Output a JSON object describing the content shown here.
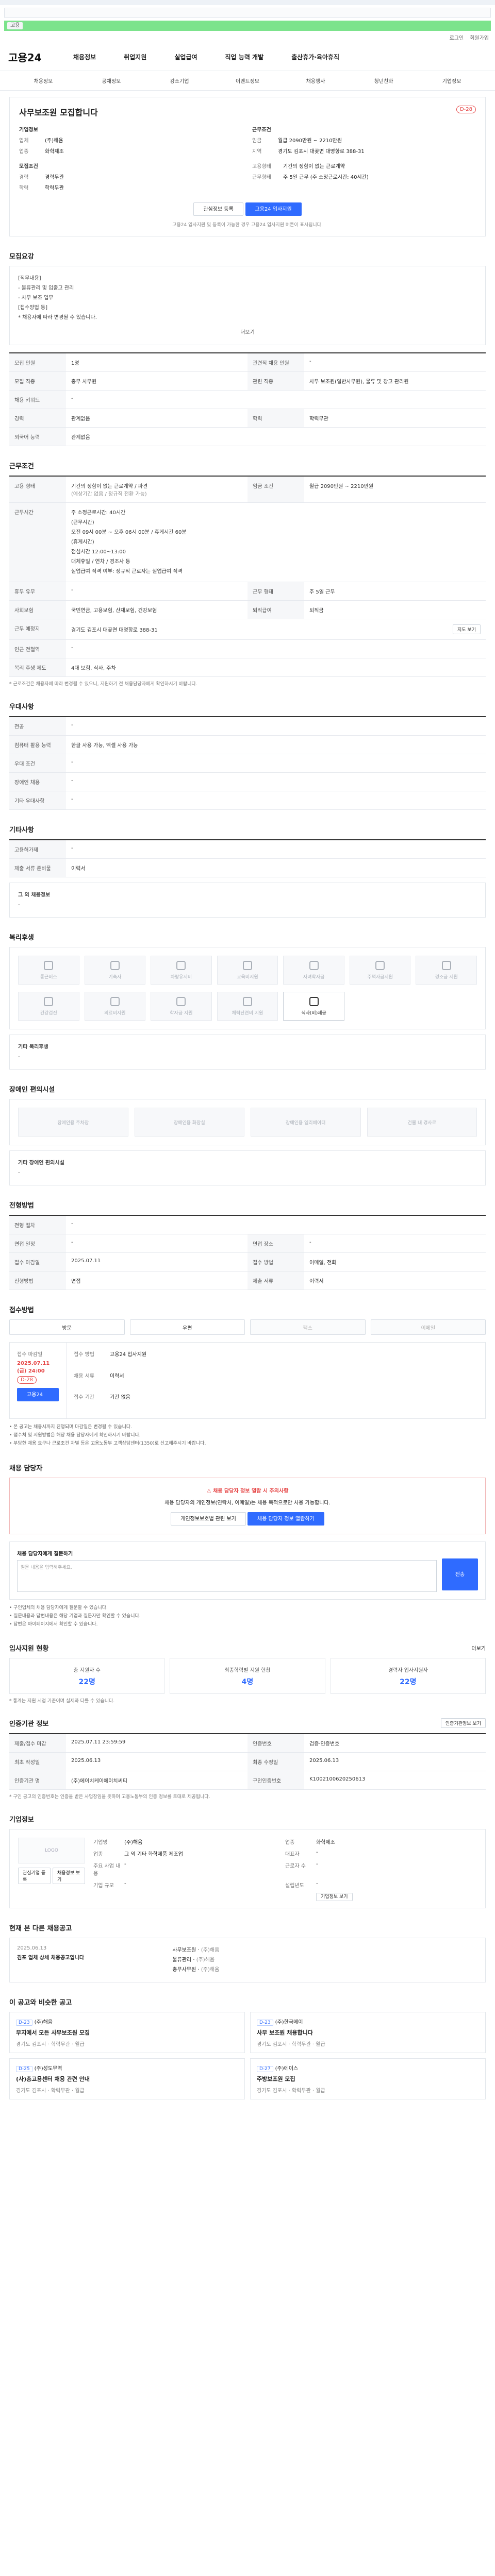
{
  "top": {
    "login": "로그인",
    "join": "회원가입"
  },
  "gnb": {
    "logo": "고용24",
    "menu": [
      "채용정보",
      "취업지원",
      "실업급여",
      "직업 능력 개발",
      "출산휴가·육아휴직"
    ]
  },
  "subnav": [
    "채용정보",
    "공채정보",
    "강소기업",
    "이벤트정보",
    "채용행사",
    "청년친화",
    "기업정보"
  ],
  "job": {
    "title": "사무보조원 모집합니다",
    "dday": "D-28",
    "company_title": "기업정보",
    "company_kv": [
      [
        "업체",
        "(주)해윰"
      ],
      [
        "업종",
        "화학제조"
      ]
    ],
    "cond_title": "모집조건",
    "cond_kv": [
      [
        "경력",
        "경력무관"
      ],
      [
        "학력",
        "학력무관"
      ]
    ],
    "work_title": "근무조건",
    "work_kv": [
      [
        "임금",
        "월급 2090만원 ~ 2210만원"
      ],
      [
        "지역",
        "경기도 김포시 대곶면 대명항로 388-31"
      ]
    ],
    "work_kv2": [
      [
        "고용형태",
        "기간의 정함이 없는 근로계약"
      ],
      [
        "근무형태",
        "주 5일 근무 (주 소정근로시간: 40시간)"
      ]
    ],
    "btn_apply": "고용24 입사지원",
    "btn_interest": "관심정보 등록",
    "note": "고용24 입사지원 및 등록이 가능한 경우 고용24 입사지원 버튼이 표시됩니다."
  },
  "recruit": {
    "section": "모집요강",
    "text": [
      "[직무내용]",
      "- 물류관리 및 입출고 관리",
      "- 사무 보조 업무",
      "[접수방법 등]",
      "* 채용자에 따라 변경될 수 있습니다."
    ],
    "more": "더보기",
    "rows": [
      [
        "모집 인원",
        "1명",
        "관련직 채용 인원",
        "-"
      ],
      [
        "모집 직종",
        "총무 사무원",
        "관련 직종",
        "사무 보조원(일반사무원), 물류 및 창고 관리원"
      ],
      [
        "채용 키워드",
        "-",
        "",
        ""
      ],
      [
        "경력",
        "관계없음",
        "학력",
        "학력무관"
      ],
      [
        "외국어 능력",
        "관계없음",
        "",
        ""
      ]
    ]
  },
  "work": {
    "section": "근무조건",
    "employ_type": "기간의 정함이 없는 근로계약 / 파견",
    "employ_type_sub": "(예상기간 없음 / 정규직 전환 가능)",
    "wage": "월급 2090만원 ~ 2210만원",
    "hours_label": "근무시간",
    "hours": [
      "주 소정근로시간: 40시간",
      "(근무시간)",
      "오전 09시 00분 ~ 오후 06시 00분 / 휴게시간 60분",
      "(휴게시간)",
      "점심시간 12:00~13:00",
      "대체휴일 / 연차 / 경조사 등",
      "실업급여 적격 여부: 정규직 근로자는 실업급여 적격"
    ],
    "rows": [
      [
        "휴무 유무",
        "-",
        "근무 형태",
        "주 5일 근무"
      ],
      [
        "사회보험",
        "국민연금, 고용보험, 산재보험, 건강보험",
        "퇴직급여",
        "퇴직금"
      ],
      [
        "근무 예정지",
        "경기도 김포시 대곶면 대명항로 388-31",
        "",
        ""
      ],
      [
        "인근 전철역",
        "-",
        "",
        ""
      ],
      [
        "복리 후생 제도",
        "4대 보험, 식사, 주차",
        "",
        ""
      ]
    ],
    "map_btn": "지도 보기",
    "tip": "* 근로조건은 채용자에 따라 변경될 수 있으니, 지원하기 전 채용담당자에게 확인하시기 바랍니다."
  },
  "apply_info": {
    "section": "우대사항",
    "rows": [
      [
        "전공",
        "-"
      ],
      [
        "컴퓨터 활용 능력",
        "한글 사용 가능, 엑셀 사용 가능"
      ],
      [
        "우대 조건",
        "-"
      ],
      [
        "장애인 채용",
        "-"
      ],
      [
        "기타 우대사항",
        "-"
      ]
    ]
  },
  "etc": {
    "section": "기타사항",
    "rows": [
      [
        "고용허가제",
        "-"
      ],
      [
        "제출 서류 준비물",
        "이력서"
      ]
    ],
    "sub": "그 외 채용정보",
    "sub_value": "-"
  },
  "welfare": {
    "section": "복리후생",
    "items": [
      "통근버스",
      "기숙사",
      "차량유지비",
      "교육비지원",
      "자녀학자금",
      "주택자금지원",
      "경조금 지원",
      "건강검진",
      "의료비지원",
      "학자금 지원",
      "체력단련비 지원",
      "식사(비)제공"
    ],
    "on_index": 11,
    "sub": "기타 복리후생",
    "sub_value": "-"
  },
  "disability": {
    "section": "장애인 편의시설",
    "items": [
      "장애인용 주차장",
      "장애인용 화장실",
      "장애인용 엘리베이터",
      "건물 내 경사로"
    ],
    "sub": "기타 장애인 편의시설",
    "sub_value": "-"
  },
  "process": {
    "section": "전형방법",
    "rows": [
      [
        "전형 절차",
        "-",
        "",
        ""
      ],
      [
        "면접 일정",
        "-",
        "면접 장소",
        "-"
      ],
      [
        "접수 마감일",
        "2025.07.11",
        "접수 방법",
        "이메일, 전화"
      ],
      [
        "전형방법",
        "면접",
        "제출 서류",
        "이력서"
      ]
    ]
  },
  "register": {
    "section": "접수방법",
    "methods": [
      "방문",
      "우편",
      "팩스",
      "이메일"
    ],
    "methods_off": [
      false,
      false,
      true,
      true
    ]
  },
  "period": {
    "left_title": "접수 마감일",
    "left_date": "2025.07.11 (금) 24:00",
    "left_dday": "D-28",
    "right_rows": [
      [
        "접수 방법",
        "고용24 입사지원"
      ],
      [
        "채용 서류",
        "이력서"
      ],
      [
        "접수 기간",
        "기간 없음"
      ]
    ],
    "apply": "고용24 입사지원",
    "notes": [
      "• 본 공고는 채용시까지 진행되며 마감일은 변경될 수 있습니다.",
      "• 접수처 및 지원방법은 해당 채용 담당자에게 확인하시기 바랍니다.",
      "• 부당한 채용 요구나 근로조건 차별 등은 고용노동부 고객상담센터(1350)로 신고해주시기 바랍니다."
    ]
  },
  "contact": {
    "section": "채용 담당자",
    "warn_title": "채용 담당자 정보 열람 시 주의사항",
    "warn_text": "채용 담당자의 개인정보(연락처, 이메일)는 채용 목적으로만 사용 가능합니다.",
    "btns": [
      "개인정보보호법 관련 보기",
      "채용 담당자 정보 열람하기"
    ],
    "q_title": "채용 담당자에게 질문하기",
    "q_placeholder": "질문 내용을 입력해주세요.",
    "q_btn": "전송",
    "tips": [
      "• 구인업체의 채용 담당자에게 질문할 수 있습니다.",
      "• 질문내용과 답변내용은 해당 기업과 질문자만 확인할 수 있습니다.",
      "• 답변은 마이페이지에서 확인할 수 있습니다."
    ]
  },
  "stats": {
    "section": "입사지원 현황",
    "more": "더보기",
    "items": [
      [
        "총 지원자 수",
        "22명"
      ],
      [
        "최종학력별 지원 현황",
        "4명"
      ],
      [
        "경력자 입사지원자",
        "22명"
      ]
    ],
    "note": "* 통계는 지원 시점 기준이며 실제와 다를 수 있습니다."
  },
  "recruit_info": {
    "section": "인증기관 정보",
    "btn": "인증기관정보 보기",
    "rows": [
      [
        "제출/접수 마감",
        "2025.07.11 23:59:59",
        "인증번호",
        "검증·인증번호"
      ],
      [
        "최초 작성일",
        "2025.06.13",
        "최종 수정일",
        "2025.06.13"
      ],
      [
        "인증기관 명",
        "(주)에이치케이에이치씨티",
        "구인인증번호",
        "K1002100620250613"
      ]
    ],
    "note": "* 구인 공고의 인증번호는 인증을 받은 사업장임을 뜻하며 고용노동부의 인증 정보를 토대로 제공됩니다."
  },
  "company": {
    "section": "기업정보",
    "logo": "LOGO",
    "name": "(주)해윰",
    "rows": [
      [
        "기업명",
        "(주)해윰",
        "업종",
        "화학제조"
      ],
      [
        "업종",
        "그 외 기타 화학제품 제조업",
        "대표자",
        "-"
      ],
      [
        "주요 사업 내용",
        "-",
        "근로자 수",
        "-"
      ],
      [
        "기업 규모",
        "-",
        "설립년도",
        "-"
      ]
    ],
    "btns": [
      "관심기업 등록",
      "채용정보 보기",
      "기업정보 보기"
    ]
  },
  "same": {
    "section": "현재 본 다른 채용공고",
    "date": "2025.06.13",
    "title": "김포 업체 상세 채용공고입니다",
    "items": [
      [
        "사무보조원",
        "(주)해윰"
      ],
      [
        "물류관리",
        "(주)해윰"
      ],
      [
        "총무사무원",
        "(주)해윰"
      ]
    ]
  },
  "recommend": {
    "section": "이 공고와 비슷한 공고",
    "cards": [
      {
        "tag": "D-23",
        "company": "(주)해윰",
        "title": "무지에서 모든 사무보조원 모집",
        "meta": "경기도 김포시 · 학력무관 · 월급"
      },
      {
        "tag": "D-23",
        "company": "(주)한국메이",
        "title": "사무 보조원 채용합니다",
        "meta": "경기도 김포시 · 학력무관 · 월급"
      },
      {
        "tag": "D-25",
        "company": "(주)성도무역",
        "title": "(사)총고용센터 채용 관련 안내",
        "meta": "경기도 김포시 · 학력무관 · 월급"
      },
      {
        "tag": "D-27",
        "company": "(주)에이스",
        "title": "주방보조원 모집",
        "meta": "경기도 김포시 · 학력무관 · 월급"
      }
    ]
  },
  "colors": {
    "accent": "#2f6bff",
    "danger": "#e64545",
    "banner": "#7ce38c"
  }
}
